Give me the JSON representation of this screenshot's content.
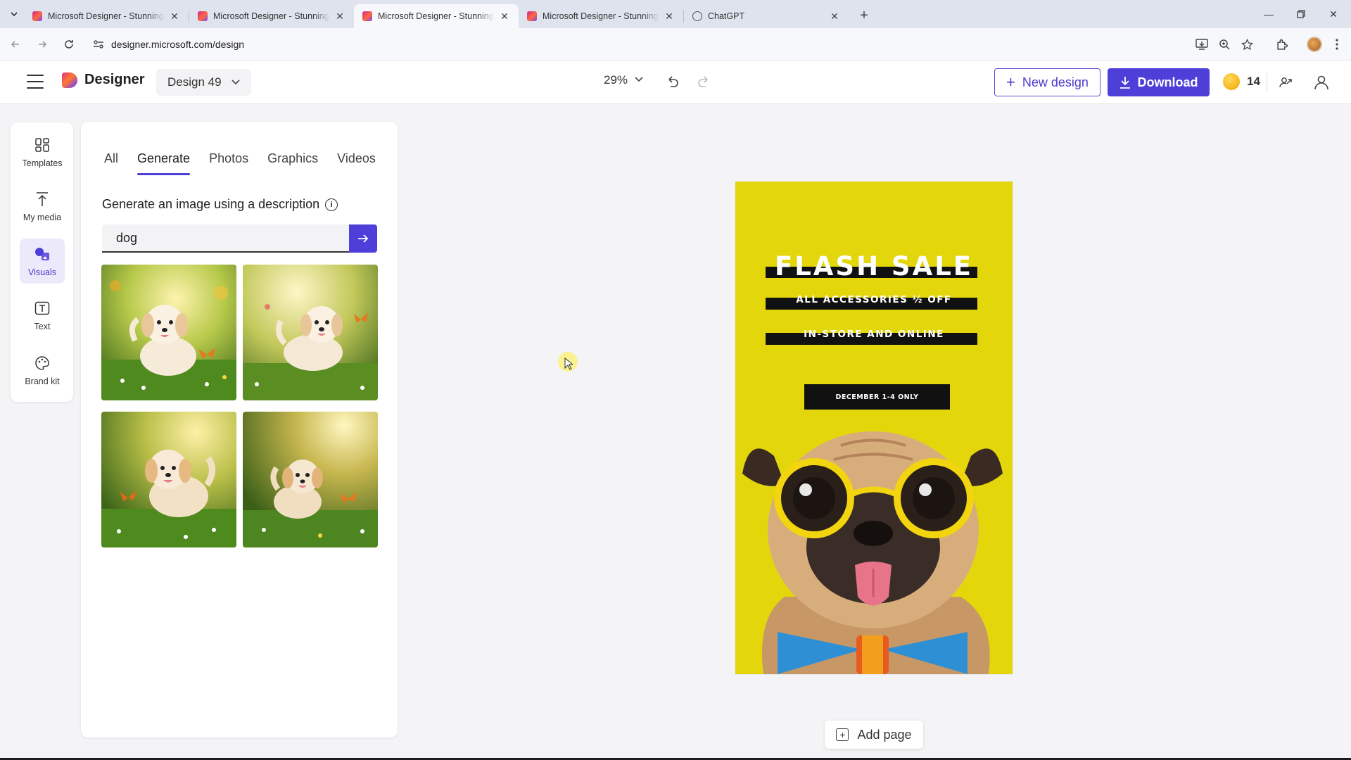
{
  "browser": {
    "tabs": [
      {
        "title": "Microsoft Designer - Stunning designs in a flash",
        "active": false
      },
      {
        "title": "Microsoft Designer - Stunning designs in a flash",
        "active": false
      },
      {
        "title": "Microsoft Designer - Stunning designs in a flash",
        "active": true
      },
      {
        "title": "Microsoft Designer - Stunning designs in a flash",
        "active": false
      },
      {
        "title": "ChatGPT",
        "active": false
      }
    ],
    "url": "designer.microsoft.com/design"
  },
  "header": {
    "brand": "Designer",
    "design_name": "Design 49",
    "zoom": "29%",
    "new_design_label": "New design",
    "download_label": "Download",
    "credits": "14"
  },
  "rail": {
    "items": [
      {
        "label": "Templates",
        "icon": "templates-icon"
      },
      {
        "label": "My media",
        "icon": "upload-icon"
      },
      {
        "label": "Visuals",
        "icon": "visuals-icon",
        "active": true
      },
      {
        "label": "Text",
        "icon": "text-icon"
      },
      {
        "label": "Brand kit",
        "icon": "palette-icon"
      }
    ]
  },
  "panel": {
    "tabs": [
      "All",
      "Generate",
      "Photos",
      "Graphics",
      "Videos"
    ],
    "active_tab": "Generate",
    "generate_label": "Generate an image using a description",
    "prompt_value": "dog"
  },
  "artboard": {
    "title": "FLASH SALE",
    "line1": "ALL ACCESSORIES ½ OFF",
    "line2": "IN-STORE AND ONLINE",
    "date": "DECEMBER 1-4 ONLY",
    "background": "#e3d70c"
  },
  "canvas": {
    "add_page_label": "Add page"
  },
  "colors": {
    "accent": "#4f3fd9"
  }
}
